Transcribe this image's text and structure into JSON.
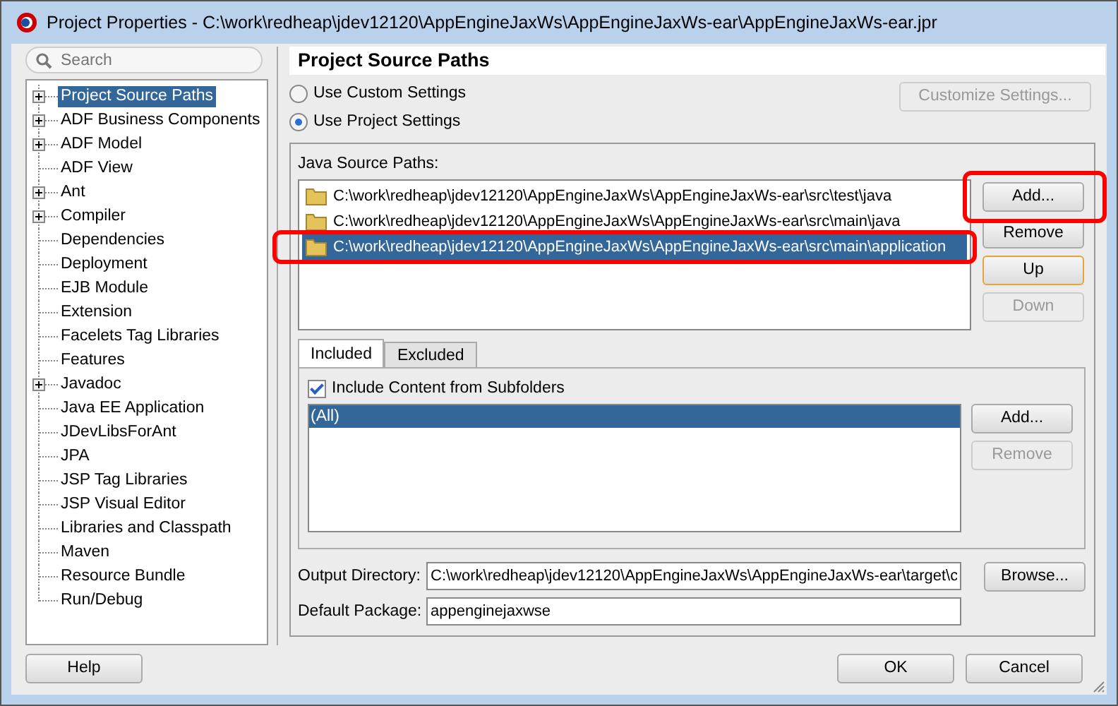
{
  "window": {
    "title": "Project Properties - C:\\work\\redheap\\jdev12120\\AppEngineJaxWs\\AppEngineJaxWs-ear\\AppEngineJaxWs-ear.jpr"
  },
  "sidebar": {
    "search_placeholder": "Search",
    "items": [
      {
        "label": "Project Source Paths",
        "expandable": true,
        "selected": true
      },
      {
        "label": "ADF Business Components",
        "expandable": true,
        "selected": false
      },
      {
        "label": "ADF Model",
        "expandable": true,
        "selected": false
      },
      {
        "label": "ADF View",
        "expandable": false,
        "selected": false
      },
      {
        "label": "Ant",
        "expandable": true,
        "selected": false
      },
      {
        "label": "Compiler",
        "expandable": true,
        "selected": false
      },
      {
        "label": "Dependencies",
        "expandable": false,
        "selected": false
      },
      {
        "label": "Deployment",
        "expandable": false,
        "selected": false
      },
      {
        "label": "EJB Module",
        "expandable": false,
        "selected": false
      },
      {
        "label": "Extension",
        "expandable": false,
        "selected": false
      },
      {
        "label": "Facelets Tag Libraries",
        "expandable": false,
        "selected": false
      },
      {
        "label": "Features",
        "expandable": false,
        "selected": false
      },
      {
        "label": "Javadoc",
        "expandable": true,
        "selected": false
      },
      {
        "label": "Java EE Application",
        "expandable": false,
        "selected": false
      },
      {
        "label": "JDevLibsForAnt",
        "expandable": false,
        "selected": false
      },
      {
        "label": "JPA",
        "expandable": false,
        "selected": false
      },
      {
        "label": "JSP Tag Libraries",
        "expandable": false,
        "selected": false
      },
      {
        "label": "JSP Visual Editor",
        "expandable": false,
        "selected": false
      },
      {
        "label": "Libraries and Classpath",
        "expandable": false,
        "selected": false
      },
      {
        "label": "Maven",
        "expandable": false,
        "selected": false
      },
      {
        "label": "Resource Bundle",
        "expandable": false,
        "selected": false
      },
      {
        "label": "Run/Debug",
        "expandable": false,
        "selected": false
      }
    ]
  },
  "panel": {
    "title": "Project Source Paths",
    "options": [
      {
        "label": "Use Custom Settings",
        "selected": false
      },
      {
        "label": "Use Project Settings",
        "selected": true
      }
    ],
    "customize_button": {
      "label": "Customize Settings...",
      "disabled": true
    },
    "source_paths": {
      "label": "Java Source Paths:",
      "items": [
        {
          "path": "C:\\work\\redheap\\jdev12120\\AppEngineJaxWs\\AppEngineJaxWs-ear\\src\\test\\java",
          "selected": false,
          "highlighted": false
        },
        {
          "path": "C:\\work\\redheap\\jdev12120\\AppEngineJaxWs\\AppEngineJaxWs-ear\\src\\main\\java",
          "selected": false,
          "highlighted": false
        },
        {
          "path": "C:\\work\\redheap\\jdev12120\\AppEngineJaxWs\\AppEngineJaxWs-ear\\src\\main\\application",
          "selected": true,
          "highlighted": true
        }
      ],
      "buttons": [
        {
          "label": "Add...",
          "disabled": false,
          "focused": false,
          "highlighted": true
        },
        {
          "label": "Remove",
          "disabled": false,
          "focused": false,
          "highlighted": false
        },
        {
          "label": "Up",
          "disabled": false,
          "focused": true,
          "highlighted": false
        },
        {
          "label": "Down",
          "disabled": true,
          "focused": false,
          "highlighted": false
        }
      ]
    },
    "filter_tabs": [
      {
        "label": "Included",
        "selected": true
      },
      {
        "label": "Excluded",
        "selected": false
      }
    ],
    "include_subfolders": {
      "label": "Include Content from Subfolders",
      "checked": true
    },
    "patterns": [
      {
        "label": "(All)",
        "selected": true
      }
    ],
    "pattern_buttons": [
      {
        "label": "Add...",
        "disabled": false
      },
      {
        "label": "Remove",
        "disabled": true
      }
    ],
    "output_directory": {
      "label": "Output Directory:",
      "value": "C:\\work\\redheap\\jdev12120\\AppEngineJaxWs\\AppEngineJaxWs-ear\\target\\c",
      "button": "Browse..."
    },
    "default_package": {
      "label": "Default Package:",
      "value": "appenginejaxwse"
    }
  },
  "footer": {
    "help": "Help",
    "ok": "OK",
    "cancel": "Cancel"
  }
}
